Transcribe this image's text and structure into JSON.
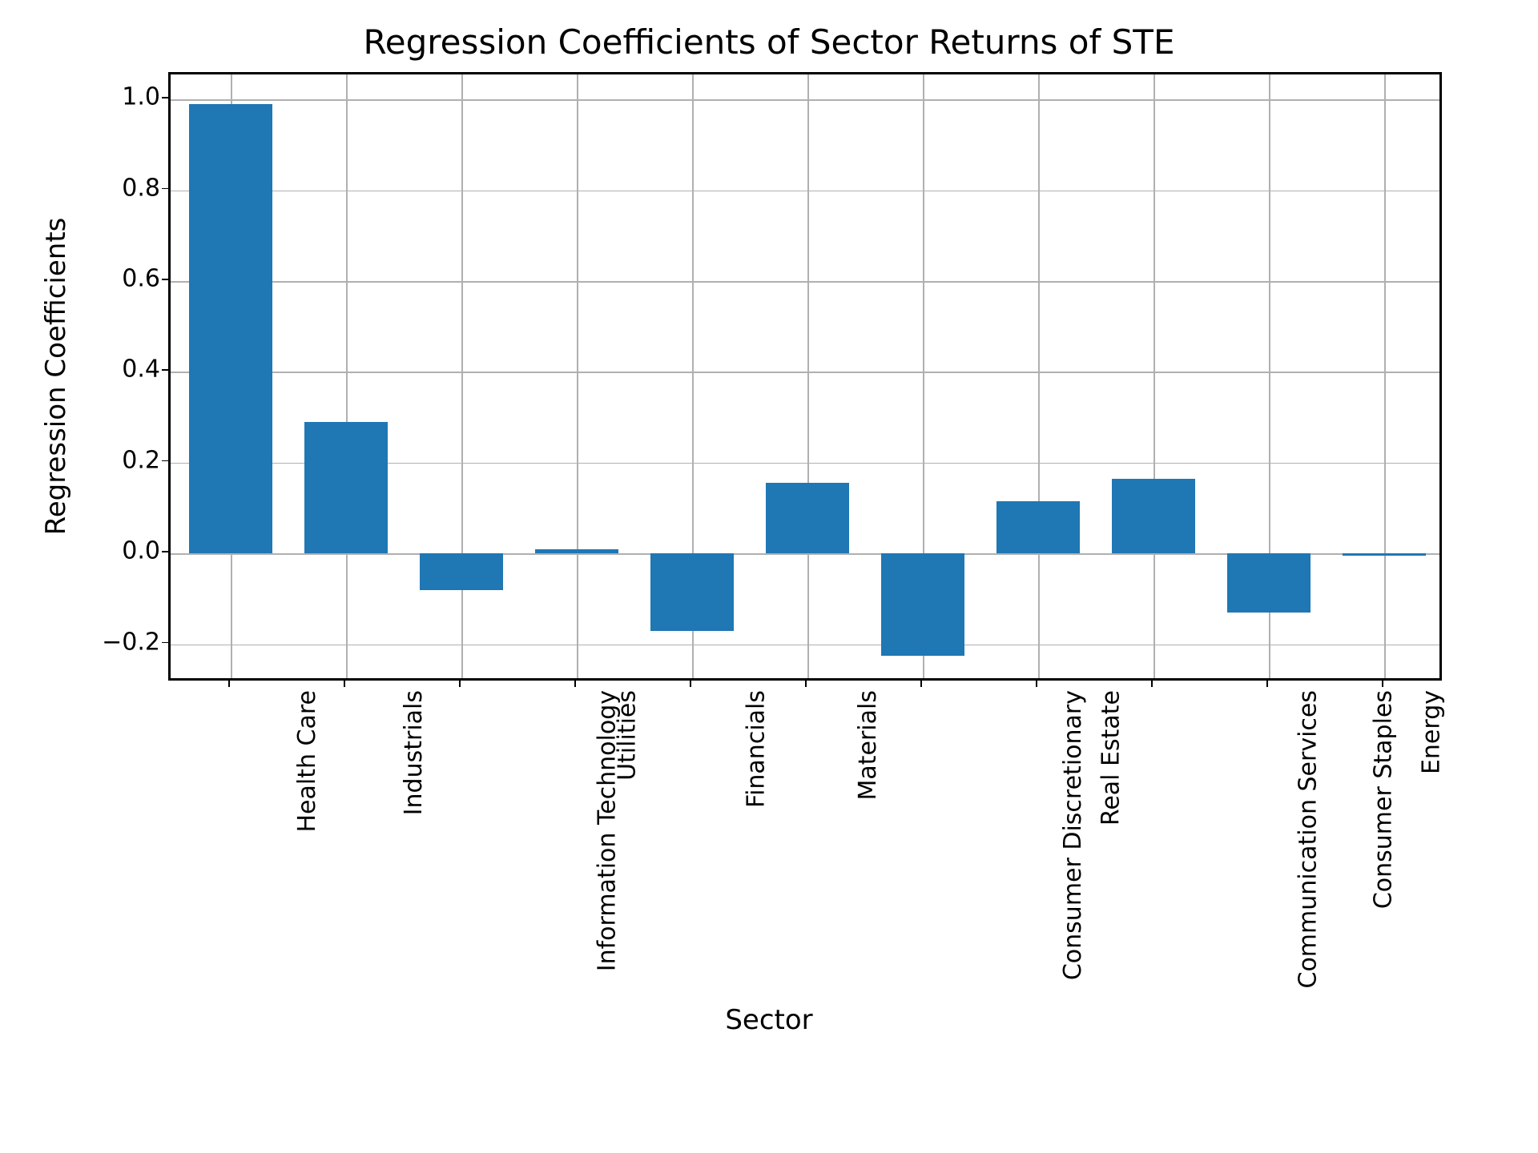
{
  "chart_data": {
    "type": "bar",
    "title": "Regression Coefficients of Sector Returns of STE",
    "xlabel": "Sector",
    "ylabel": "Regression Coefficients",
    "categories": [
      "Health Care",
      "Industrials",
      "Information Technology",
      "Utilities",
      "Financials",
      "Materials",
      "Consumer Discretionary",
      "Real Estate",
      "Communication Services",
      "Consumer Staples",
      "Energy"
    ],
    "values": [
      0.99,
      0.29,
      -0.08,
      0.01,
      -0.17,
      0.155,
      -0.225,
      0.115,
      0.165,
      -0.13,
      -0.005
    ],
    "ylim": [
      -0.28,
      1.05
    ],
    "yticks": [
      -0.2,
      0.0,
      0.2,
      0.4,
      0.6,
      0.8,
      1.0
    ],
    "ytick_labels": [
      "−0.2",
      "0.0",
      "0.2",
      "0.4",
      "0.6",
      "0.8",
      "1.0"
    ],
    "bar_color": "#1f77b4"
  }
}
